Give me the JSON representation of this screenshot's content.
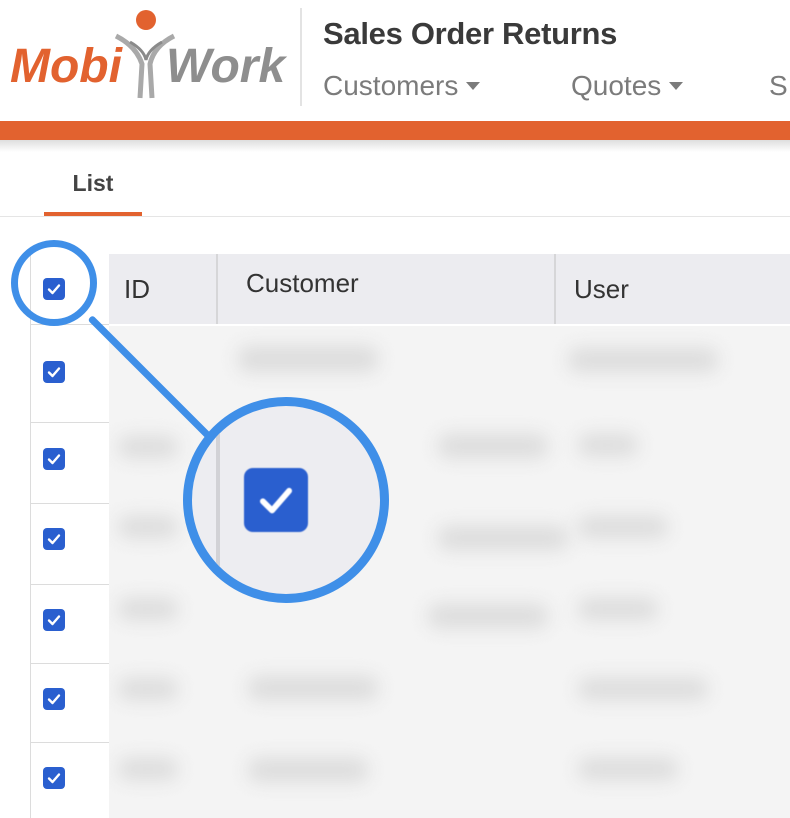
{
  "header": {
    "logo_text_left": "Mobi",
    "logo_text_right": "Work",
    "page_title": "Sales Order Returns",
    "nav": [
      {
        "label": "Customers",
        "has_dropdown": true
      },
      {
        "label": "Quotes",
        "has_dropdown": true
      },
      {
        "label": "S",
        "has_dropdown": false
      }
    ]
  },
  "tabs": [
    {
      "label": "List",
      "active": true
    }
  ],
  "table": {
    "columns": [
      "ID",
      "Customer",
      "User"
    ],
    "header_checkbox_checked": true,
    "row_checkboxes_checked": [
      true,
      true,
      true,
      true,
      true,
      true
    ]
  },
  "zoom_callout": {
    "icon": "checkbox-checked-icon"
  },
  "colors": {
    "accent_orange": "#e2622f",
    "checkbox_blue": "#2a5fcf",
    "callout_blue": "#3f8fe8"
  }
}
